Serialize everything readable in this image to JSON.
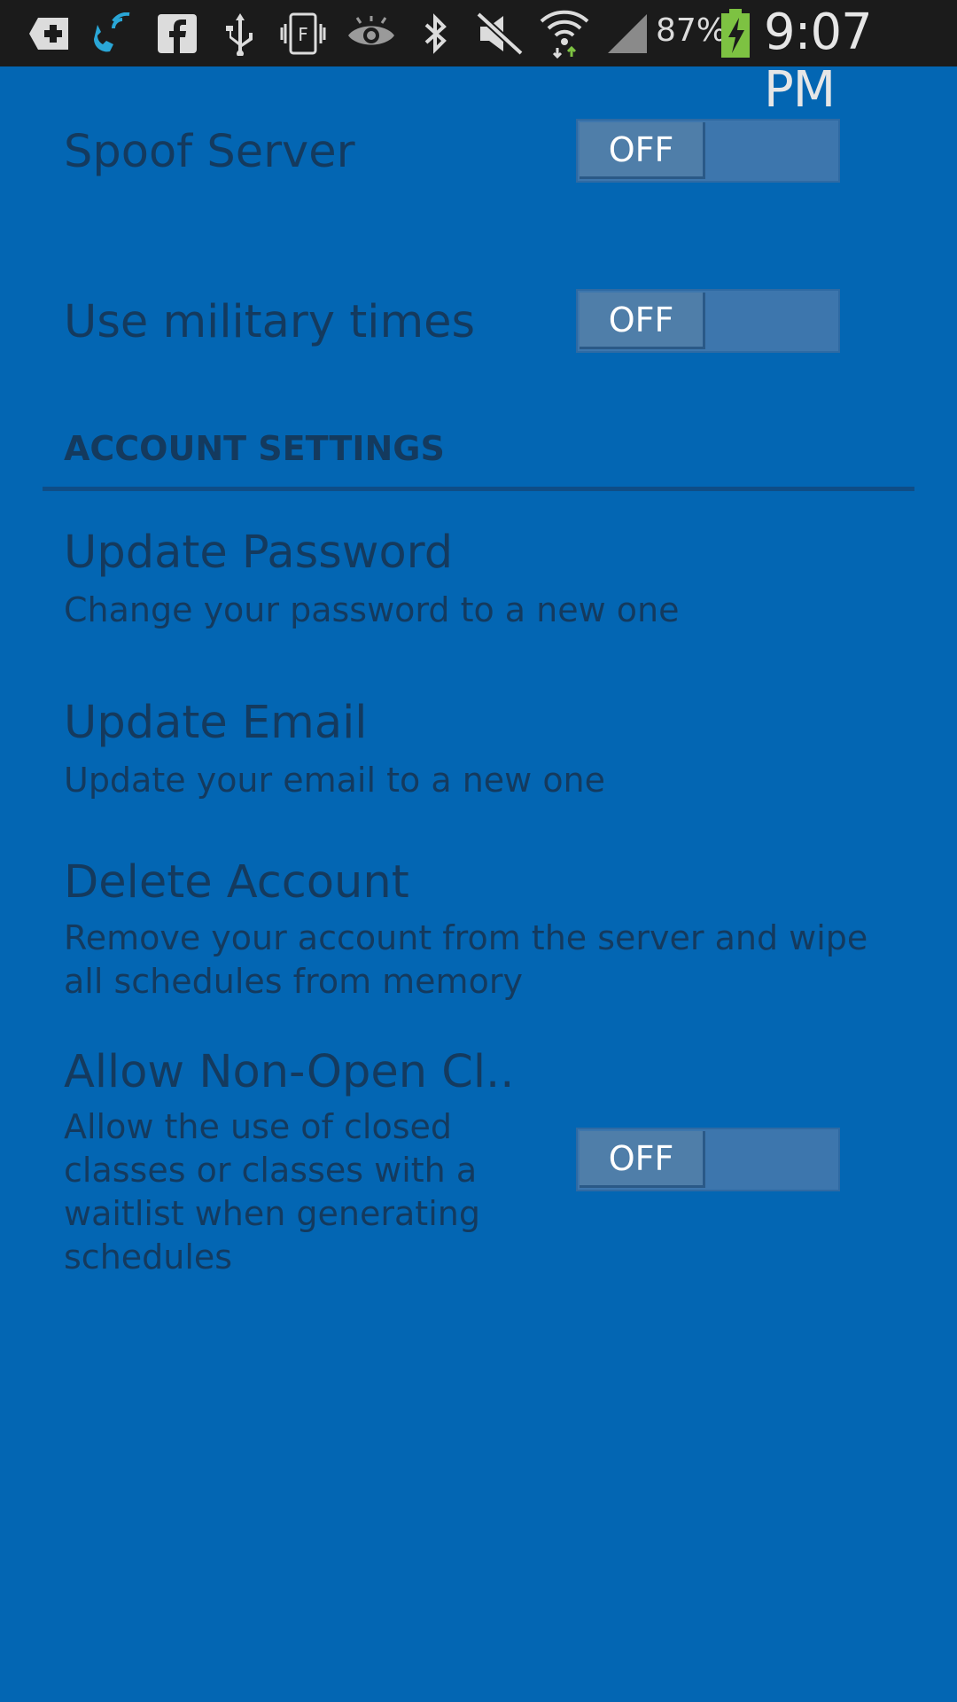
{
  "status_bar": {
    "battery_percent": "87%",
    "time": "9:07 PM",
    "icons": [
      "plus-notification-icon",
      "wifi-calling-icon",
      "facebook-icon",
      "usb-icon",
      "screen-mirror-icon",
      "eye-icon",
      "bluetooth-icon",
      "mute-icon",
      "wifi-icon",
      "cellular-signal-icon",
      "battery-charging-icon"
    ]
  },
  "settings": {
    "spoof_server": {
      "title": "Spoof Server",
      "toggle": "OFF"
    },
    "military_times": {
      "title": "Use military times",
      "toggle": "OFF"
    },
    "account_section": {
      "header": "ACCOUNT SETTINGS"
    },
    "update_password": {
      "title": "Update Password",
      "summary": "Change your password to a new one"
    },
    "update_email": {
      "title": "Update Email",
      "summary": "Update your email to a new one"
    },
    "delete_account": {
      "title": "Delete Account",
      "summary": "Remove your account from the server and wipe all schedules from memory"
    },
    "allow_non_open": {
      "title": "Allow Non-Open Cl..",
      "summary": "Allow the use of closed classes or classes with a waitlist when generating schedules",
      "toggle": "OFF"
    }
  },
  "colors": {
    "background": "#0366b3",
    "text": "#143a5e",
    "status_bar": "#1b1b1b"
  }
}
